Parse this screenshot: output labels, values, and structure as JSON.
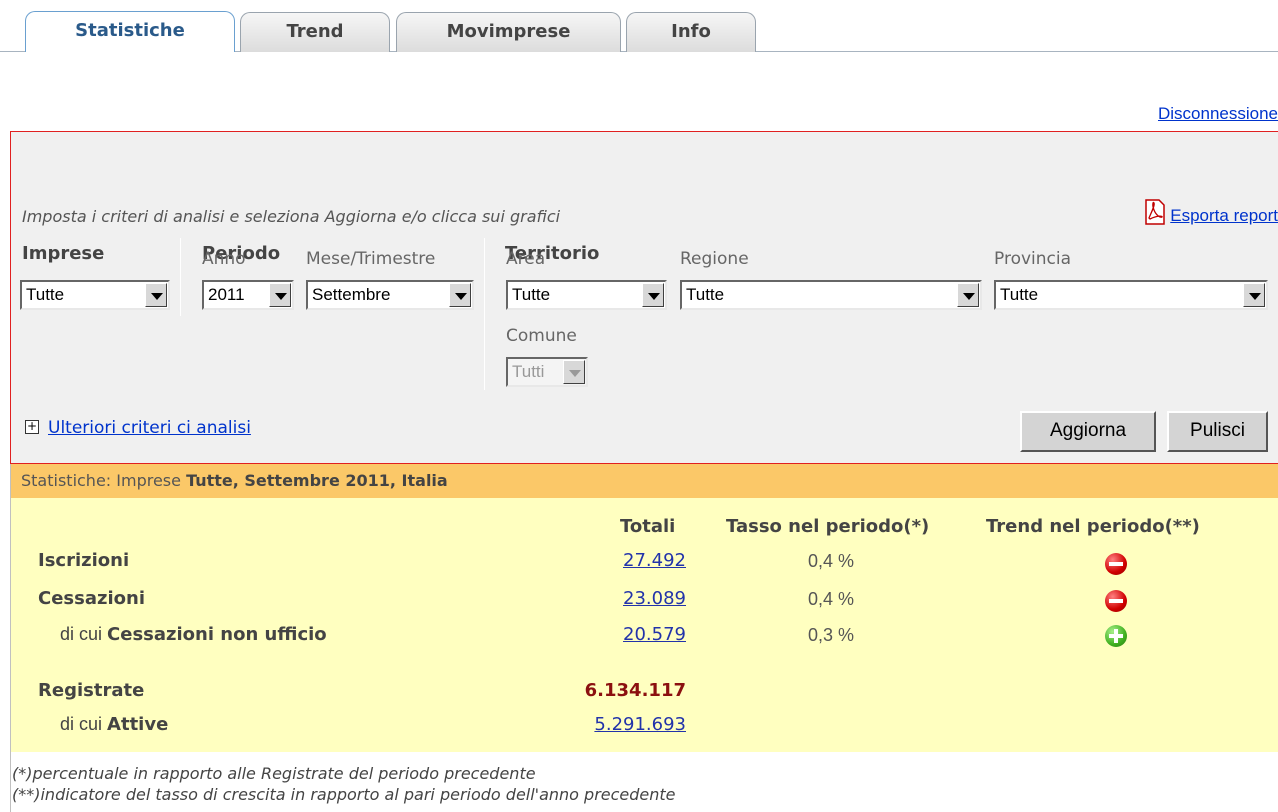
{
  "tabs": [
    {
      "label": "Statistiche",
      "active": true
    },
    {
      "label": "Trend",
      "active": false
    },
    {
      "label": "Movimprese",
      "active": false
    },
    {
      "label": "Info",
      "active": false
    }
  ],
  "logout_label": "Disconnessione",
  "filters": {
    "hint": "Imposta i criteri di analisi e seleziona Aggiorna e/o clicca sui grafici",
    "export_label": "Esporta report",
    "imprese": {
      "heading": "Imprese",
      "value": "Tutte"
    },
    "periodo": {
      "heading": "Periodo",
      "anno_label": "Anno",
      "anno_value": "2011",
      "mese_label": "Mese/Trimestre",
      "mese_value": "Settembre"
    },
    "territorio": {
      "heading": "Territorio",
      "area_label": "Area",
      "area_value": "Tutte",
      "regione_label": "Regione",
      "regione_value": "Tutte",
      "provincia_label": "Provincia",
      "provincia_value": "Tutte",
      "comune_label": "Comune",
      "comune_value": "Tutti"
    },
    "more_label": "Ulteriori criteri ci analisi",
    "update_button": "Aggiorna",
    "clear_button": "Pulisci"
  },
  "results": {
    "title_prefix": "Statistiche: Imprese ",
    "title_bold": "Tutte, Settembre 2011, Italia",
    "col_totali": "Totali",
    "col_tasso": "Tasso nel periodo(*)",
    "col_trend": "Trend nel periodo(**)",
    "rows": [
      {
        "label": "Iscrizioni",
        "total": "27.492",
        "rate": "0,4 %",
        "trend": "down"
      },
      {
        "label": "Cessazioni",
        "total": "23.089",
        "rate": "0,4 %",
        "trend": "down"
      },
      {
        "label_prefix": "di cui ",
        "label": "Cessazioni non ufficio",
        "total": "20.579",
        "rate": "0,3 %",
        "trend": "up"
      }
    ],
    "registrate_label": "Registrate",
    "registrate_total": "6.134.117",
    "attive_prefix": "di cui ",
    "attive_label": "Attive",
    "attive_total": "5.291.693"
  },
  "notes": [
    "(*)percentuale in rapporto alle Registrate del periodo precedente",
    "(**)indicatore del tasso di crescita in rapporto al pari periodo dell'anno precedente"
  ],
  "icons": {
    "pdf": "pdf-icon",
    "expand": "plus-box-icon",
    "trend_down": "red-minus-icon",
    "trend_up": "green-plus-icon"
  }
}
